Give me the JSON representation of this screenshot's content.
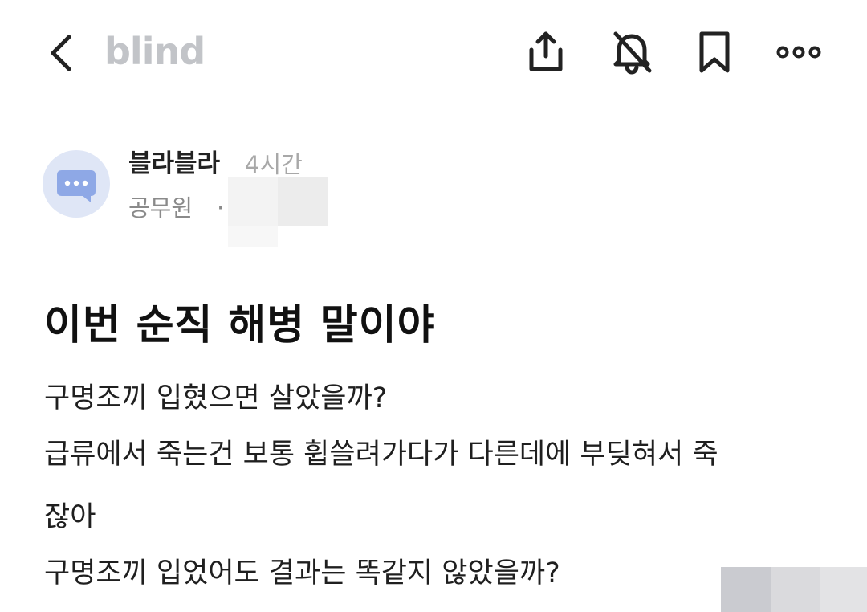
{
  "header": {
    "logo": "blind",
    "icons": [
      "back-icon",
      "share-icon",
      "bell-off-icon",
      "bookmark-icon",
      "more-icon"
    ]
  },
  "author": {
    "name": "블라블라",
    "time": "4시간",
    "company": "공무원",
    "separator": "·",
    "avatar_icon": "chat-bubble-icon"
  },
  "post": {
    "title": "이번 순직 해병 말이야",
    "lines": [
      "구명조끼 입혔으면 살았을까?",
      "급류에서 죽는건 보통 휩쓸려가다가 다른데에 부딪혀서 죽",
      "잖아",
      "구명조끼 입었어도 결과는 똑같지 않았을까?"
    ]
  },
  "colors": {
    "logo": "#c2c4c8",
    "avatar_bg": "#dfe6f6",
    "avatar_bubble": "#8ea8e6"
  }
}
